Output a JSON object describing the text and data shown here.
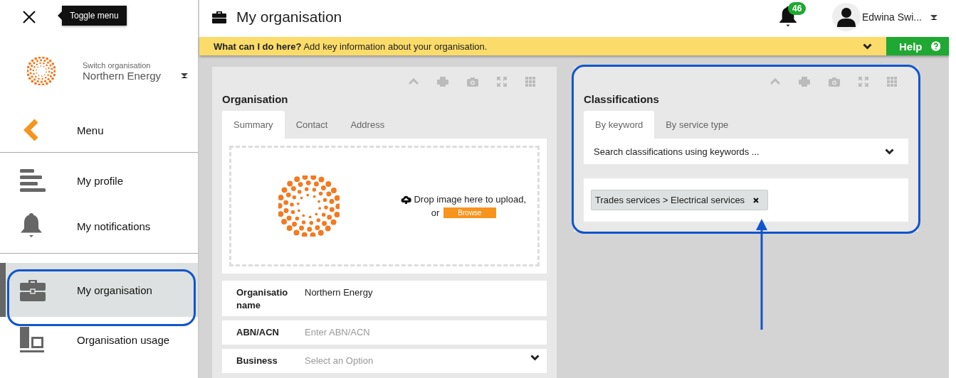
{
  "sidebar": {
    "tooltip": "Toggle menu",
    "switch_label": "Switch organisation",
    "organisation": "Northern Energy",
    "back_label": "Menu",
    "items": [
      {
        "label": "My profile",
        "kind": "profile",
        "selected": false,
        "outlined": false
      },
      {
        "label": "My notifications",
        "kind": "bell",
        "selected": false,
        "outlined": false
      },
      {
        "label": "My organisation",
        "kind": "briefcase",
        "selected": true,
        "outlined": true
      },
      {
        "label": "Organisation usage",
        "kind": "usage",
        "selected": false,
        "outlined": false
      }
    ]
  },
  "header": {
    "title": "My organisation",
    "notification_count": "46",
    "user": "Edwina Swi..."
  },
  "info_bar": {
    "text": "**What can I do here?** Add key information about your organisation.",
    "help": "Help"
  },
  "organisation_panel": {
    "title": "Organisation",
    "outlined": false,
    "tabs": [
      {
        "label": "Summary",
        "selected": true
      },
      {
        "label": "Contact",
        "selected": false
      },
      {
        "label": "Address",
        "selected": false
      }
    ],
    "upload": {
      "text": "Drop image here to upload,",
      "or": "or",
      "button": "Browse"
    },
    "fields": [
      {
        "label": "Organisatio name",
        "kind": "text",
        "value": "Northern Energy"
      },
      {
        "label": "ABN/ACN",
        "kind": "text",
        "placeholder": "Enter ABN/ACN"
      },
      {
        "label": "Business",
        "kind": "select",
        "placeholder": "Select an Option"
      }
    ]
  },
  "classifications_panel": {
    "title": "Classifications",
    "outlined": true,
    "tabs": [
      {
        "label": "By keyword",
        "selected": true
      },
      {
        "label": "By service type",
        "selected": false
      }
    ],
    "search": {
      "placeholder": "Search classifications using keywords ..."
    },
    "tags": [
      {
        "label": "Trades services > Electrical services"
      }
    ]
  }
}
